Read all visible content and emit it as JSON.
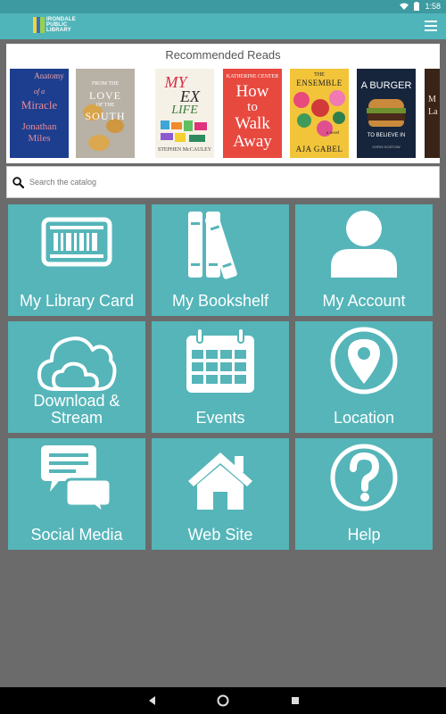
{
  "status": {
    "time": "1:58"
  },
  "app": {
    "logo_line1": "IRONDALE",
    "logo_line2": "PUBLIC",
    "logo_line3": "LIBRARY"
  },
  "recommended": {
    "title": "Recommended Reads",
    "books": [
      {
        "line1": "Anatomy",
        "line2": "of a",
        "line3": "Miracle",
        "line4": "Jonathan",
        "line5": "Miles"
      },
      {
        "line1": "FROM THE",
        "line2": "LOVE",
        "line3": "OF THE",
        "line4": "SOUTH"
      },
      {
        "line1": "MY",
        "line2": "EX",
        "line3": "LIFE",
        "line4": "STEPHEN McCAULEY"
      },
      {
        "line1": "KATHERINE CENTER",
        "line2": "How",
        "line3": "to",
        "line4": "Walk",
        "line5": "Away"
      },
      {
        "line1": "THE",
        "line2": "ENSEMBLE",
        "line3": "a novel",
        "line4": "AJA GABEL"
      },
      {
        "line1": "A BURGER",
        "line2": "TO BELIEVE IN",
        "line3": "CHRIS KOSTOW"
      },
      {
        "line1": "M",
        "line2": "La"
      }
    ]
  },
  "search": {
    "placeholder": "Search the catalog"
  },
  "tiles": {
    "library_card": "My Library Card",
    "bookshelf": "My Bookshelf",
    "account": "My Account",
    "download_line1": "Download &",
    "download_line2": "Stream",
    "events": "Events",
    "location": "Location",
    "social": "Social Media",
    "website": "Web Site",
    "help": "Help"
  },
  "colors": {
    "tile": "#55b5b9",
    "appbar": "#4fb5ba",
    "statusbar": "#3c9aa0",
    "background": "#6b6b6b"
  }
}
